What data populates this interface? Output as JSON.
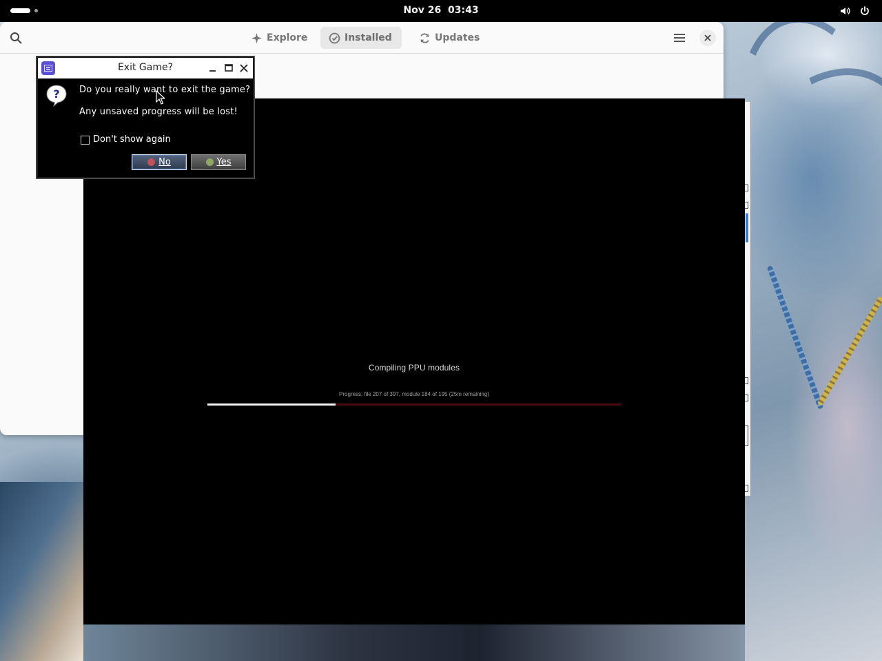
{
  "topbar": {
    "date": "Nov 26",
    "time": "03:43",
    "icons": [
      "workspace-indicator",
      "volume-icon",
      "power-icon"
    ]
  },
  "software_center": {
    "tabs": [
      {
        "label": "Explore",
        "icon": "sparkle-icon",
        "active": false
      },
      {
        "label": "Installed",
        "icon": "check-circle-icon",
        "active": true
      },
      {
        "label": "Updates",
        "icon": "refresh-icon",
        "active": false
      }
    ],
    "icons": [
      "search-icon",
      "hamburger-menu-icon",
      "close-icon"
    ]
  },
  "game": {
    "compile_title": "Compiling PPU modules",
    "progress_text": "Progress: file 207 of 397, module 184 of 195 (25m remaining)",
    "progress_fraction": 0.31,
    "colors": {
      "fill": "#f2f2f2",
      "track": "#4a0a0a"
    }
  },
  "dialog": {
    "title": "Exit Game?",
    "question": "Do you really want to exit the game?",
    "warning": "Any unsaved progress will be lost!",
    "checkbox_label": "Don't show again",
    "checkbox_checked": false,
    "buttons": [
      {
        "label": "No",
        "icon_color": "#c0505a",
        "focused": true
      },
      {
        "label": "Yes",
        "icon_color": "#8fa860",
        "focused": false
      }
    ],
    "icons": [
      "app-icon",
      "minimize-icon",
      "maximize-icon",
      "close-icon",
      "question-icon"
    ]
  }
}
